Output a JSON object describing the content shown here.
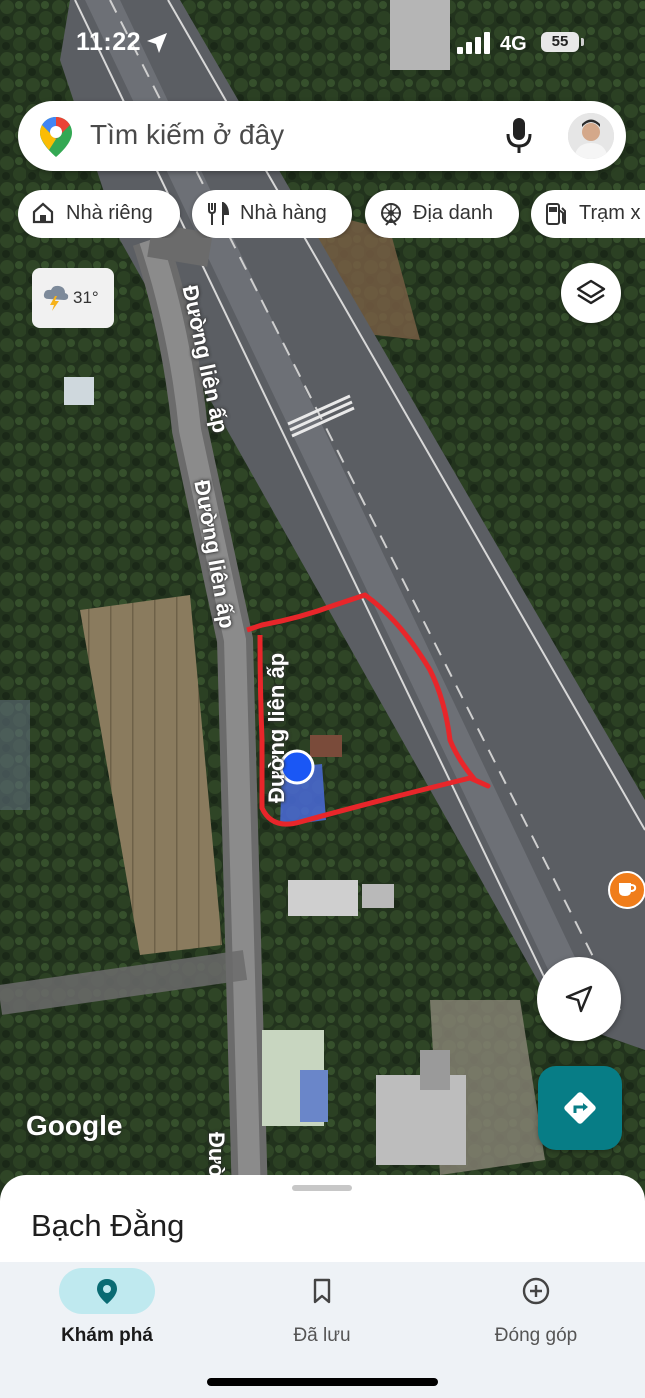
{
  "status_bar": {
    "time": "11:22",
    "network": "4G",
    "battery": "55"
  },
  "search": {
    "placeholder": "Tìm kiếm ở đây"
  },
  "chips": [
    {
      "label": "Nhà riêng",
      "icon": "home-icon"
    },
    {
      "label": "Nhà hàng",
      "icon": "restaurant-icon"
    },
    {
      "label": "Địa danh",
      "icon": "landmark-icon"
    },
    {
      "label": "Trạm x",
      "icon": "gas-station-icon"
    }
  ],
  "weather": {
    "temperature": "31°",
    "icon": "thunderstorm-icon"
  },
  "map": {
    "road_labels": [
      "Đường liên ấp",
      "Đường liên ấp",
      "Đường liên ấp",
      "Đườ"
    ],
    "attribution": "Google",
    "boundary_color": "#e8262a",
    "location_dot_color": "#1a57f5"
  },
  "place_sheet": {
    "title": "Bạch Đằng"
  },
  "bottom_nav": [
    {
      "label": "Khám phá",
      "icon": "explore-pin-icon",
      "active": true
    },
    {
      "label": "Đã lưu",
      "icon": "bookmark-icon",
      "active": false
    },
    {
      "label": "Đóng góp",
      "icon": "add-circle-icon",
      "active": false
    }
  ],
  "colors": {
    "accent": "#077d86",
    "active_nav_bg": "#bfe9ef",
    "poi_orange": "#f07d1a"
  }
}
